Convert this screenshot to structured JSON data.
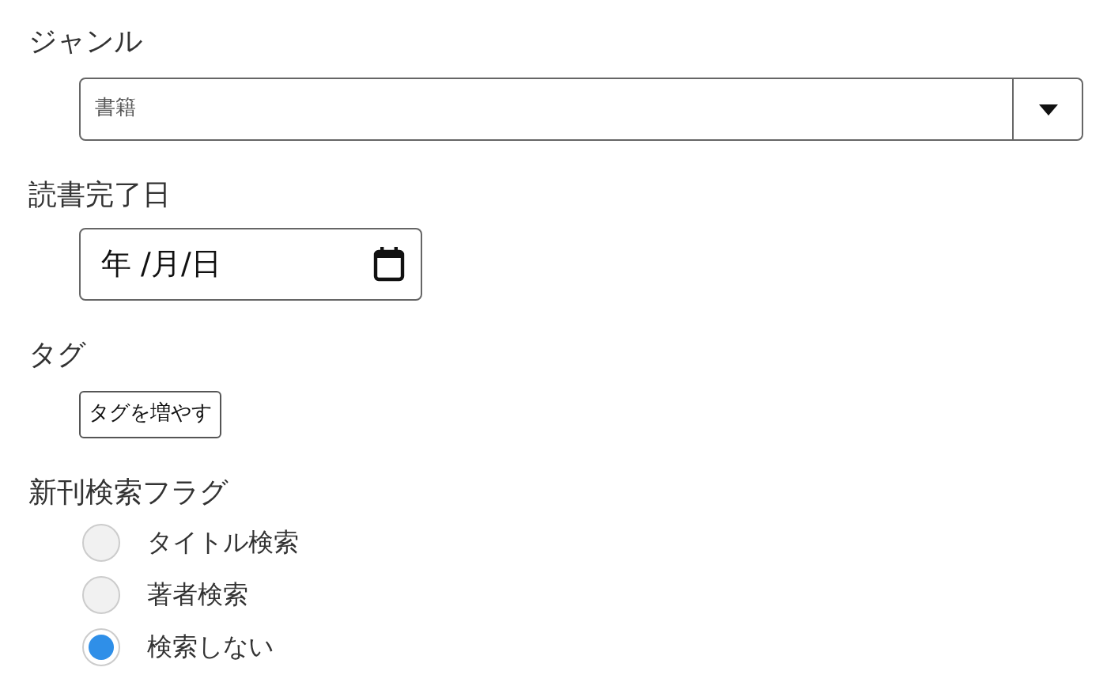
{
  "genre": {
    "label": "ジャンル",
    "value": "書籍"
  },
  "finish_date": {
    "label": "読書完了日",
    "placeholder": "年 /月/日"
  },
  "tags": {
    "label": "タグ",
    "button": "タグを増やす"
  },
  "new_release_flag": {
    "label": "新刊検索フラグ",
    "options": [
      {
        "label": "タイトル検索",
        "selected": false
      },
      {
        "label": "著者検索",
        "selected": false
      },
      {
        "label": "検索しない",
        "selected": true
      }
    ]
  }
}
